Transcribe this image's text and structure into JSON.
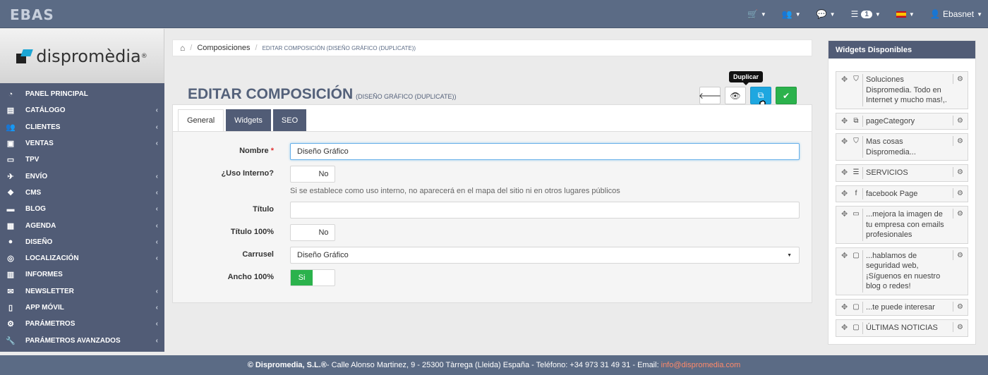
{
  "topbar": {
    "logo_text": "EBAS",
    "items": [
      {
        "icon": "cart-icon",
        "label": ""
      },
      {
        "icon": "users-icon",
        "label": ""
      },
      {
        "icon": "chat-icon",
        "label": ""
      },
      {
        "icon": "list-icon",
        "label": "",
        "badge": "1"
      },
      {
        "icon": "spain-flag-icon",
        "label": ""
      },
      {
        "icon": "user-icon",
        "label": "Ebasnet"
      }
    ]
  },
  "sidebar": {
    "brand": "dispromèdia",
    "items": [
      {
        "label": "PANEL PRINCIPAL",
        "icon": "dashboard-icon",
        "arrow": false
      },
      {
        "label": "CATÁLOGO",
        "icon": "archive-icon",
        "arrow": true
      },
      {
        "label": "CLIENTES",
        "icon": "users-icon",
        "arrow": true
      },
      {
        "label": "VENTAS",
        "icon": "money-icon",
        "arrow": true
      },
      {
        "label": "TPV",
        "icon": "credit-card-icon",
        "arrow": false
      },
      {
        "label": "ENVÍO",
        "icon": "send-icon",
        "arrow": true
      },
      {
        "label": "CMS",
        "icon": "cubes-icon",
        "arrow": true
      },
      {
        "label": "BLOG",
        "icon": "laptop-icon",
        "arrow": true
      },
      {
        "label": "AGENDA",
        "icon": "calendar-icon",
        "arrow": true
      },
      {
        "label": "DISEÑO",
        "icon": "tint-icon",
        "arrow": true
      },
      {
        "label": "LOCALIZACIÓN",
        "icon": "compass-icon",
        "arrow": true
      },
      {
        "label": "INFORMES",
        "icon": "bar-chart-icon",
        "arrow": false
      },
      {
        "label": "NEWSLETTER",
        "icon": "envelope-icon",
        "arrow": true
      },
      {
        "label": "APP MÓVIL",
        "icon": "mobile-icon",
        "arrow": true
      },
      {
        "label": "PARÁMETROS",
        "icon": "cogs-icon",
        "arrow": true
      },
      {
        "label": "PARÁMETROS AVANZADOS",
        "icon": "wrench-icon",
        "arrow": true
      }
    ]
  },
  "breadcrumb": {
    "parent": "Composiciones",
    "current": "EDITAR COMPOSICIÓN (DISEÑO GRÁFICO (DUPLICATE))"
  },
  "page": {
    "title": "EDITAR COMPOSICIÓN",
    "subtitle": "(DISEÑO GRÁFICO (DUPLICATE))",
    "tooltip": "Duplicar"
  },
  "tabs": [
    "General",
    "Widgets",
    "SEO"
  ],
  "form": {
    "nombre_label": "Nombre",
    "nombre_value": "Diseño Gráfico",
    "uso_interno_label": "¿Uso Interno?",
    "uso_interno_value": "No",
    "uso_interno_help": "Si se establece como uso interno, no aparecerá en el mapa del sitio ni en otros lugares públicos",
    "titulo_label": "Título",
    "titulo_value": "",
    "titulo100_label": "Título 100%",
    "titulo100_value": "No",
    "carrusel_label": "Carrusel",
    "carrusel_value": "Diseño Gráfico",
    "ancho_label": "Ancho 100%",
    "ancho_value": "Si"
  },
  "widgets": {
    "title": "Widgets Disponibles",
    "items": [
      {
        "label": "Soluciones Dispromedia. Todo en Internet y mucho mas!,.",
        "icon": "html5-icon"
      },
      {
        "label": "pageCategory",
        "icon": "copy-icon"
      },
      {
        "label": "Mas cosas Dispromedia...",
        "icon": "html5-icon"
      },
      {
        "label": "SERVICIOS",
        "icon": "list-icon"
      },
      {
        "label": "facebook Page",
        "icon": "facebook-icon"
      },
      {
        "label": "...mejora la imagen de tu empresa con emails profesionales",
        "icon": "credit-card-icon"
      },
      {
        "label": "...hablamos de seguridad web, ¡Síguenos en nuestro blog o redes!",
        "icon": "folder-icon"
      },
      {
        "label": "...te puede interesar",
        "icon": "folder-icon"
      },
      {
        "label": "ÚLTIMAS NOTICIAS",
        "icon": "folder-icon"
      }
    ]
  },
  "footer": {
    "company": "© Dispromedia, S.L.®",
    "address": " - Calle Alonso Martinez, 9 - 25300 Tàrrega (Lleida) España - Teléfono: +34 973 31 49 31 - Email:",
    "email": "info@dispromedia.com"
  }
}
